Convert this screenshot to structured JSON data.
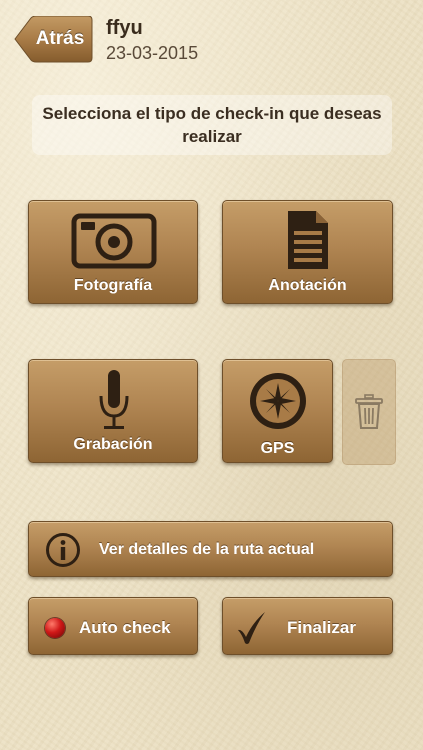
{
  "nav": {
    "back_label": "Atrás",
    "route_name": "ffyu",
    "route_date": "23-03-2015"
  },
  "instruction": "Selecciona el tipo de check-in que deseas realizar",
  "checkin_types": {
    "photo_label": "Fotografía",
    "note_label": "Anotación",
    "audio_label": "Grabación",
    "gps_label": "GPS"
  },
  "actions": {
    "route_details_label": "Ver detalles de la ruta actual",
    "auto_check_label": "Auto check",
    "finish_label": "Finalizar"
  },
  "icons": {
    "back": "chevron-left",
    "photo": "camera-icon",
    "note": "document-icon",
    "audio": "microphone-icon",
    "gps": "compass-icon",
    "delete": "trash-icon",
    "info": "info-icon",
    "auto_check": "red-dot-icon",
    "finish": "checkmark-icon"
  },
  "colors": {
    "button_brown": "#a87b47",
    "icon_dark": "#2e2013",
    "record_red": "#d01818"
  }
}
